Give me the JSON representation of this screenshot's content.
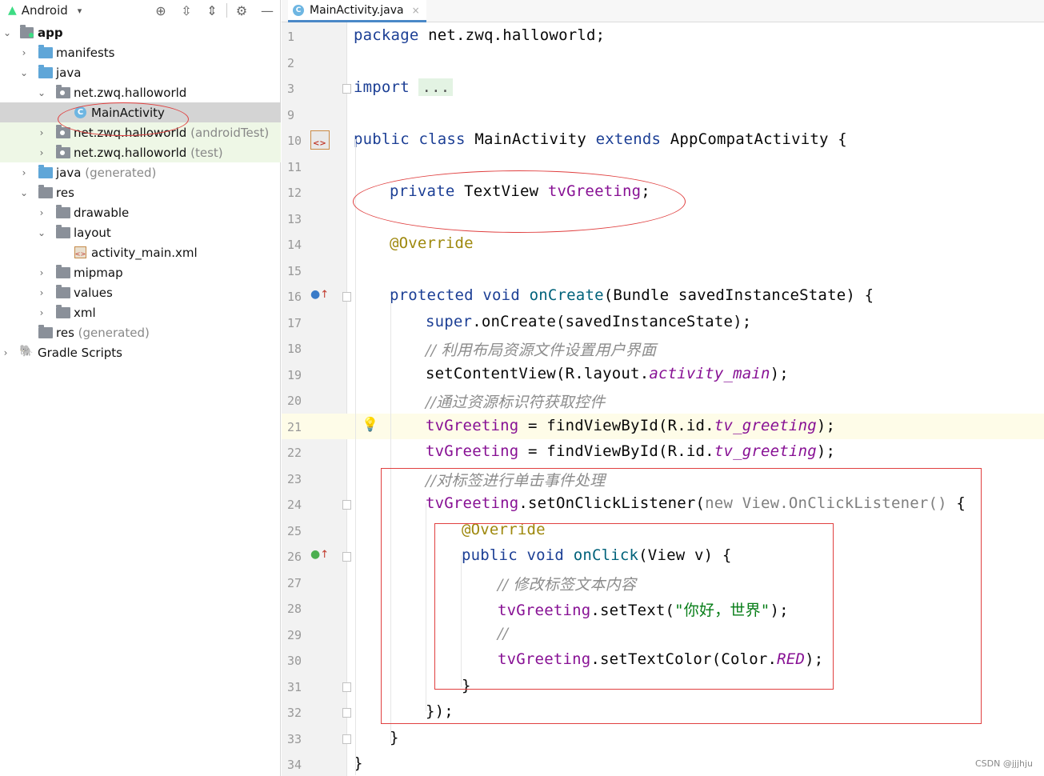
{
  "panel": {
    "view_label": "Android",
    "view_caret": "▾",
    "toolbar_icons": [
      "locate-icon",
      "expand-all-icon",
      "collapse-all-icon",
      "gear-icon",
      "hide-icon"
    ]
  },
  "tree": [
    {
      "label": "app",
      "suffix": ""
    },
    {
      "label": "manifests",
      "suffix": ""
    },
    {
      "label": "java",
      "suffix": ""
    },
    {
      "label": "net.zwq.halloworld",
      "suffix": ""
    },
    {
      "label": "MainActivity",
      "suffix": ""
    },
    {
      "label": "net.zwq.halloworld",
      "suffix": "(androidTest)"
    },
    {
      "label": "net.zwq.halloworld",
      "suffix": "(test)"
    },
    {
      "label": "java",
      "suffix": "(generated)"
    },
    {
      "label": "res",
      "suffix": ""
    },
    {
      "label": "drawable",
      "suffix": ""
    },
    {
      "label": "layout",
      "suffix": ""
    },
    {
      "label": "activity_main.xml",
      "suffix": ""
    },
    {
      "label": "mipmap",
      "suffix": ""
    },
    {
      "label": "values",
      "suffix": ""
    },
    {
      "label": "xml",
      "suffix": ""
    },
    {
      "label": "res",
      "suffix": "(generated)"
    },
    {
      "label": "Gradle Scripts",
      "suffix": ""
    }
  ],
  "editor": {
    "tab_title": "MainActivity.java",
    "tab_close": "×",
    "line_numbers": [
      "1",
      "2",
      "3",
      "9",
      "10",
      "11",
      "12",
      "13",
      "14",
      "15",
      "16",
      "17",
      "18",
      "19",
      "20",
      "21",
      "22",
      "23",
      "24",
      "25",
      "26",
      "27",
      "28",
      "29",
      "30",
      "31",
      "32",
      "33",
      "34"
    ],
    "code": {
      "package_kw": "package",
      "package_name": " net.zwq.halloworld;",
      "import_kw": "import",
      "import_dots": "...",
      "class_decl": [
        "public",
        " ",
        "class",
        " MainActivity ",
        "extends",
        " AppCompatActivity {"
      ],
      "field_decl": [
        "private",
        " TextView ",
        "tvGreeting",
        ";"
      ],
      "override1": "@Override",
      "oncreate": [
        "protected",
        " ",
        "void",
        " ",
        "onCreate",
        "(Bundle savedInstanceState) {"
      ],
      "super_call": [
        "super",
        ".onCreate(savedInstanceState);"
      ],
      "comment1": "// 利用布局资源文件设置用户界面",
      "setcontent": [
        "setContentView(R.layout.",
        "activity_main",
        ");"
      ],
      "comment2": "//通过资源标识符获取控件",
      "find1": [
        "tvGreeting",
        " = findViewById(R.id.",
        "tv_greeting",
        ");"
      ],
      "find2": [
        "tvGreeting",
        " = findViewById(R.id.",
        "tv_greeting",
        ");"
      ],
      "comment3": "//对标签进行单击事件处理",
      "setlistener": [
        "tvGreeting",
        ".setOnClickListener(",
        "new View.OnClickListener()",
        " {"
      ],
      "override2": "@Override",
      "onclick": [
        "public",
        " ",
        "void",
        " ",
        "onClick",
        "(View v) {"
      ],
      "comment4": "// 修改标签文本内容",
      "settext": [
        "tvGreeting",
        ".setText(",
        "\"你好，世界\"",
        ");"
      ],
      "comment5": "//",
      "setcolor": [
        "tvGreeting",
        ".setTextColor(Color.",
        "RED",
        ");"
      ],
      "close_inner": "}",
      "close_listener": "});",
      "close_method": "}",
      "close_class": "}"
    }
  },
  "watermark": "CSDN @jjjhju"
}
